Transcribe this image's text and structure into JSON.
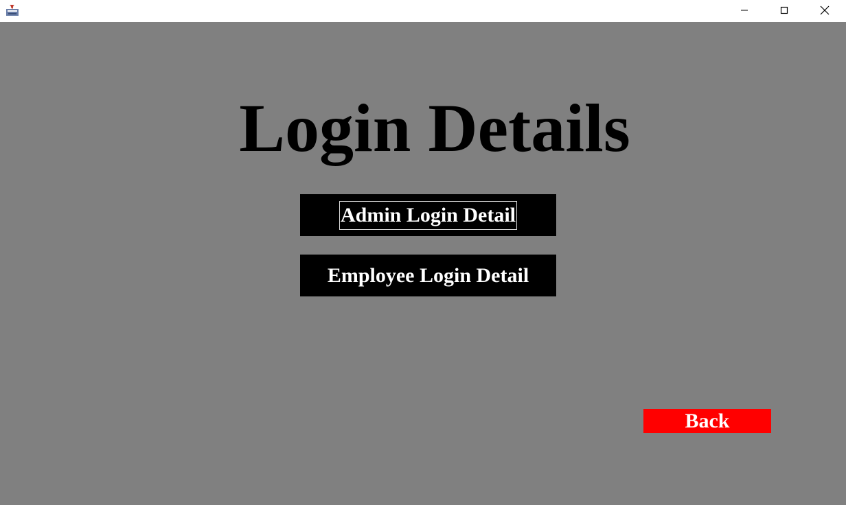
{
  "window": {
    "icon": "java-app-icon",
    "controls": {
      "minimize_icon": "minimize-icon",
      "maximize_icon": "maximize-icon",
      "close_icon": "close-icon"
    }
  },
  "main": {
    "title": "Login Details",
    "admin_button_label": "Admin Login Detail",
    "employee_button_label": "Employee Login Detail",
    "back_button_label": "Back"
  },
  "colors": {
    "background": "#808080",
    "button_background": "#000000",
    "button_text": "#ffffff",
    "back_button_background": "#ff0000",
    "title_text": "#000000"
  }
}
